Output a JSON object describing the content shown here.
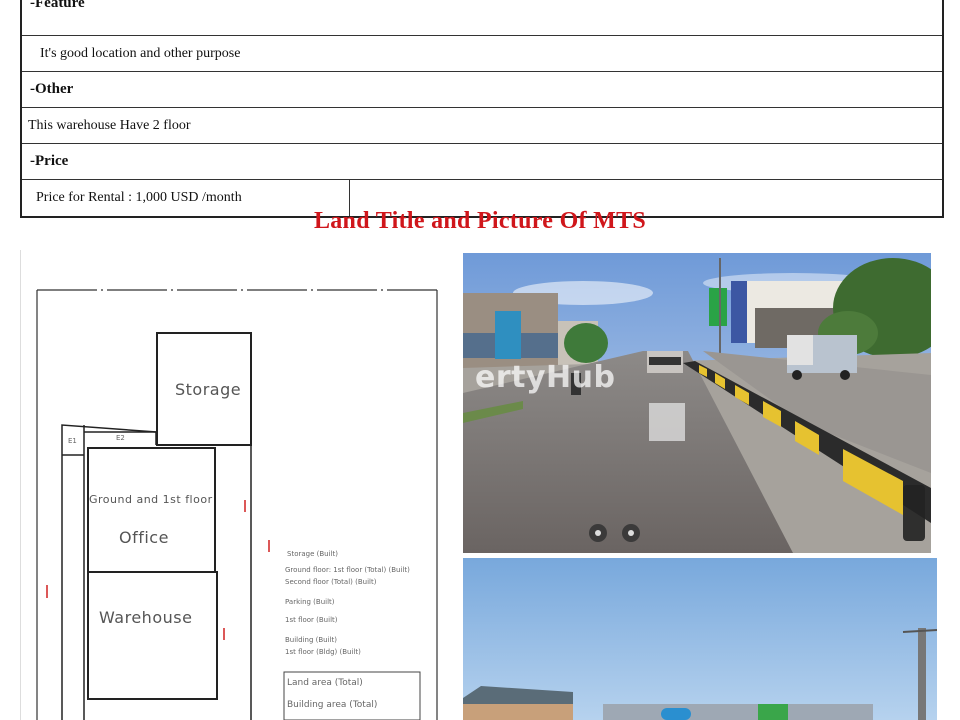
{
  "table": {
    "rows": [
      {
        "type": "head",
        "text": "-Feature"
      },
      {
        "type": "body",
        "text": "It's good location and other purpose"
      },
      {
        "type": "head",
        "text": "-Other"
      },
      {
        "type": "body",
        "text": "This warehouse Have 2 floor"
      },
      {
        "type": "head",
        "text": "-Price"
      }
    ],
    "price_row": {
      "label": "Price for Rental : 1,000 USD /month",
      "value": ""
    }
  },
  "section_title": "Land Title and Picture Of MTS",
  "plan": {
    "rooms": {
      "storage": "Storage",
      "office_heading": "Ground and 1st floor",
      "office": "Office",
      "warehouse": "Warehouse"
    },
    "side_marks": [
      "E1",
      "E2"
    ],
    "notes": [
      "Storage (Built)",
      "Ground floor: 1st floor (Total) (Built)",
      "Second floor (Total) (Built)",
      "Parking (Built)",
      "1st floor (Built)",
      "Building (Built)",
      "1st floor (Bldg) (Built)"
    ],
    "legend": [
      "Land area (Total)",
      "Building area (Total)"
    ]
  },
  "watermark": "ertyHub",
  "colors": {
    "title_red": "#d0161b",
    "border": "#222222"
  }
}
